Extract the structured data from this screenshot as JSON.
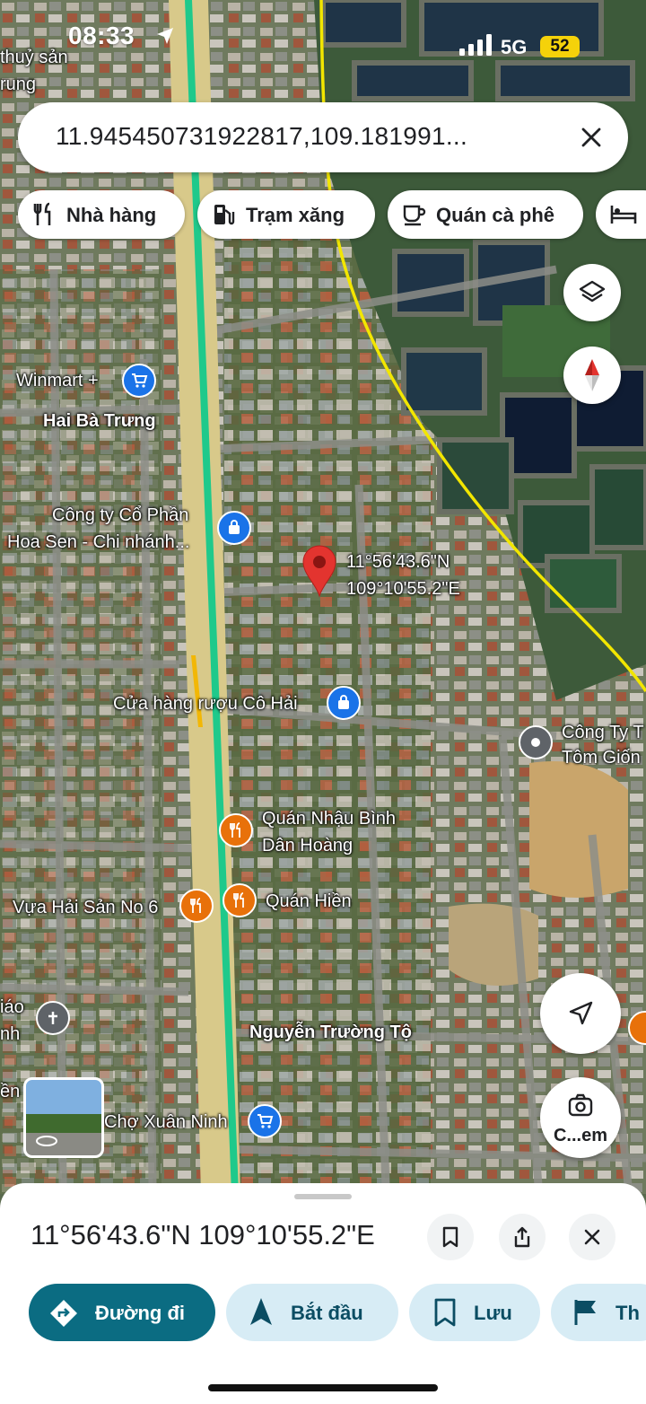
{
  "status_bar": {
    "time": "08:33",
    "network": "5G",
    "battery": "52"
  },
  "search": {
    "query": "11.945450731922817,109.181991..."
  },
  "chips": [
    {
      "label": "Nhà hàng",
      "icon": "fork-knife-icon"
    },
    {
      "label": "Trạm xăng",
      "icon": "gas-pump-icon"
    },
    {
      "label": "Quán cà phê",
      "icon": "coffee-cup-icon"
    },
    {
      "label": "",
      "icon": "bed-icon"
    }
  ],
  "map": {
    "pin_label_line1": "11°56'43.6\"N",
    "pin_label_line2": "109°10'55.2\"E",
    "places": {
      "top_left_1": "thuỷ sản",
      "top_left_2": "rung",
      "winmart": "Winmart +",
      "street_hbt": "Hai Bà Trưng",
      "hoasen_1": "Công ty Cổ Phần",
      "hoasen_2": "Hoa Sen - Chi nhánh...",
      "ruou": "Cửa hàng rượu Cô Hải",
      "congty_1": "Công Ty T",
      "congty_2": "Tôm Giốn",
      "nhau_1": "Quán Nhậu Bình",
      "nhau_2": "Dân Hoàng",
      "vua": "Vựa Hải Sản No 6",
      "hien": "Quán Hiền",
      "giao_1": "iáo",
      "giao_2": "nh",
      "en": "ền",
      "street_ntt": "Nguyễn Trường Tộ",
      "cho": "Chợ Xuân Ninh"
    },
    "camera_label": "C...em"
  },
  "sheet": {
    "coordinates": "11°56'43.6\"N 109°10'55.2\"E",
    "actions": [
      {
        "label": "Đường đi",
        "icon": "directions-icon",
        "style": "primary"
      },
      {
        "label": "Bắt đầu",
        "icon": "navigation-arrow-icon",
        "style": "tonal"
      },
      {
        "label": "Lưu",
        "icon": "bookmark-icon",
        "style": "tonal"
      },
      {
        "label": "Th",
        "icon": "flag-icon",
        "style": "tonal"
      }
    ]
  },
  "colors": {
    "primary": "#0b6c82",
    "tonal": "#d7ecf5",
    "pin": "#e3342f",
    "route": "#f2e600",
    "road_highlight": "#20c997"
  }
}
